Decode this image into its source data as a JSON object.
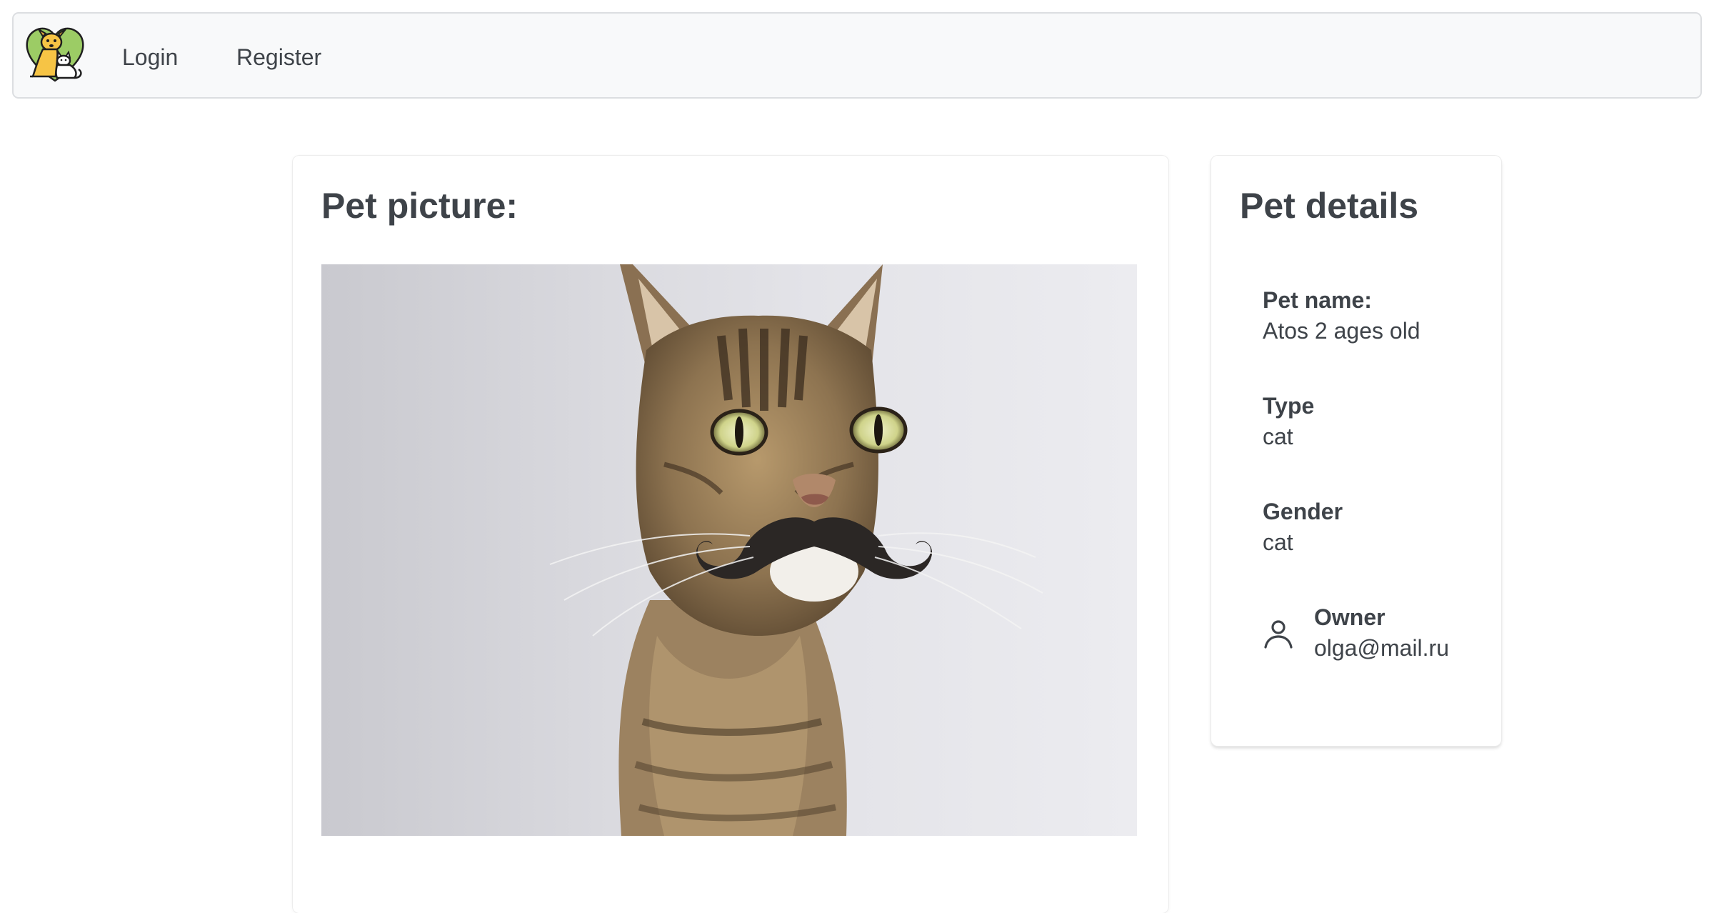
{
  "nav": {
    "logo_icon": "pets-logo-icon",
    "login_label": "Login",
    "register_label": "Register"
  },
  "picture_card": {
    "title": "Pet picture:",
    "image_icon": "cat-with-mustache-photo"
  },
  "details_card": {
    "title": "Pet details",
    "pet_name_label": "Pet name:",
    "pet_name_value": "Atos 2 ages old",
    "type_label": "Type",
    "type_value": "cat",
    "gender_label": "Gender",
    "gender_value": "cat",
    "owner_icon": "user-icon",
    "owner_label": "Owner",
    "owner_value": "olga@mail.ru"
  },
  "colors": {
    "text": "#3e4349",
    "navbar_bg": "#f8f9fa",
    "navbar_border": "#dcdee1",
    "logo_green": "#9ccc65",
    "logo_yellow": "#f6c445"
  }
}
